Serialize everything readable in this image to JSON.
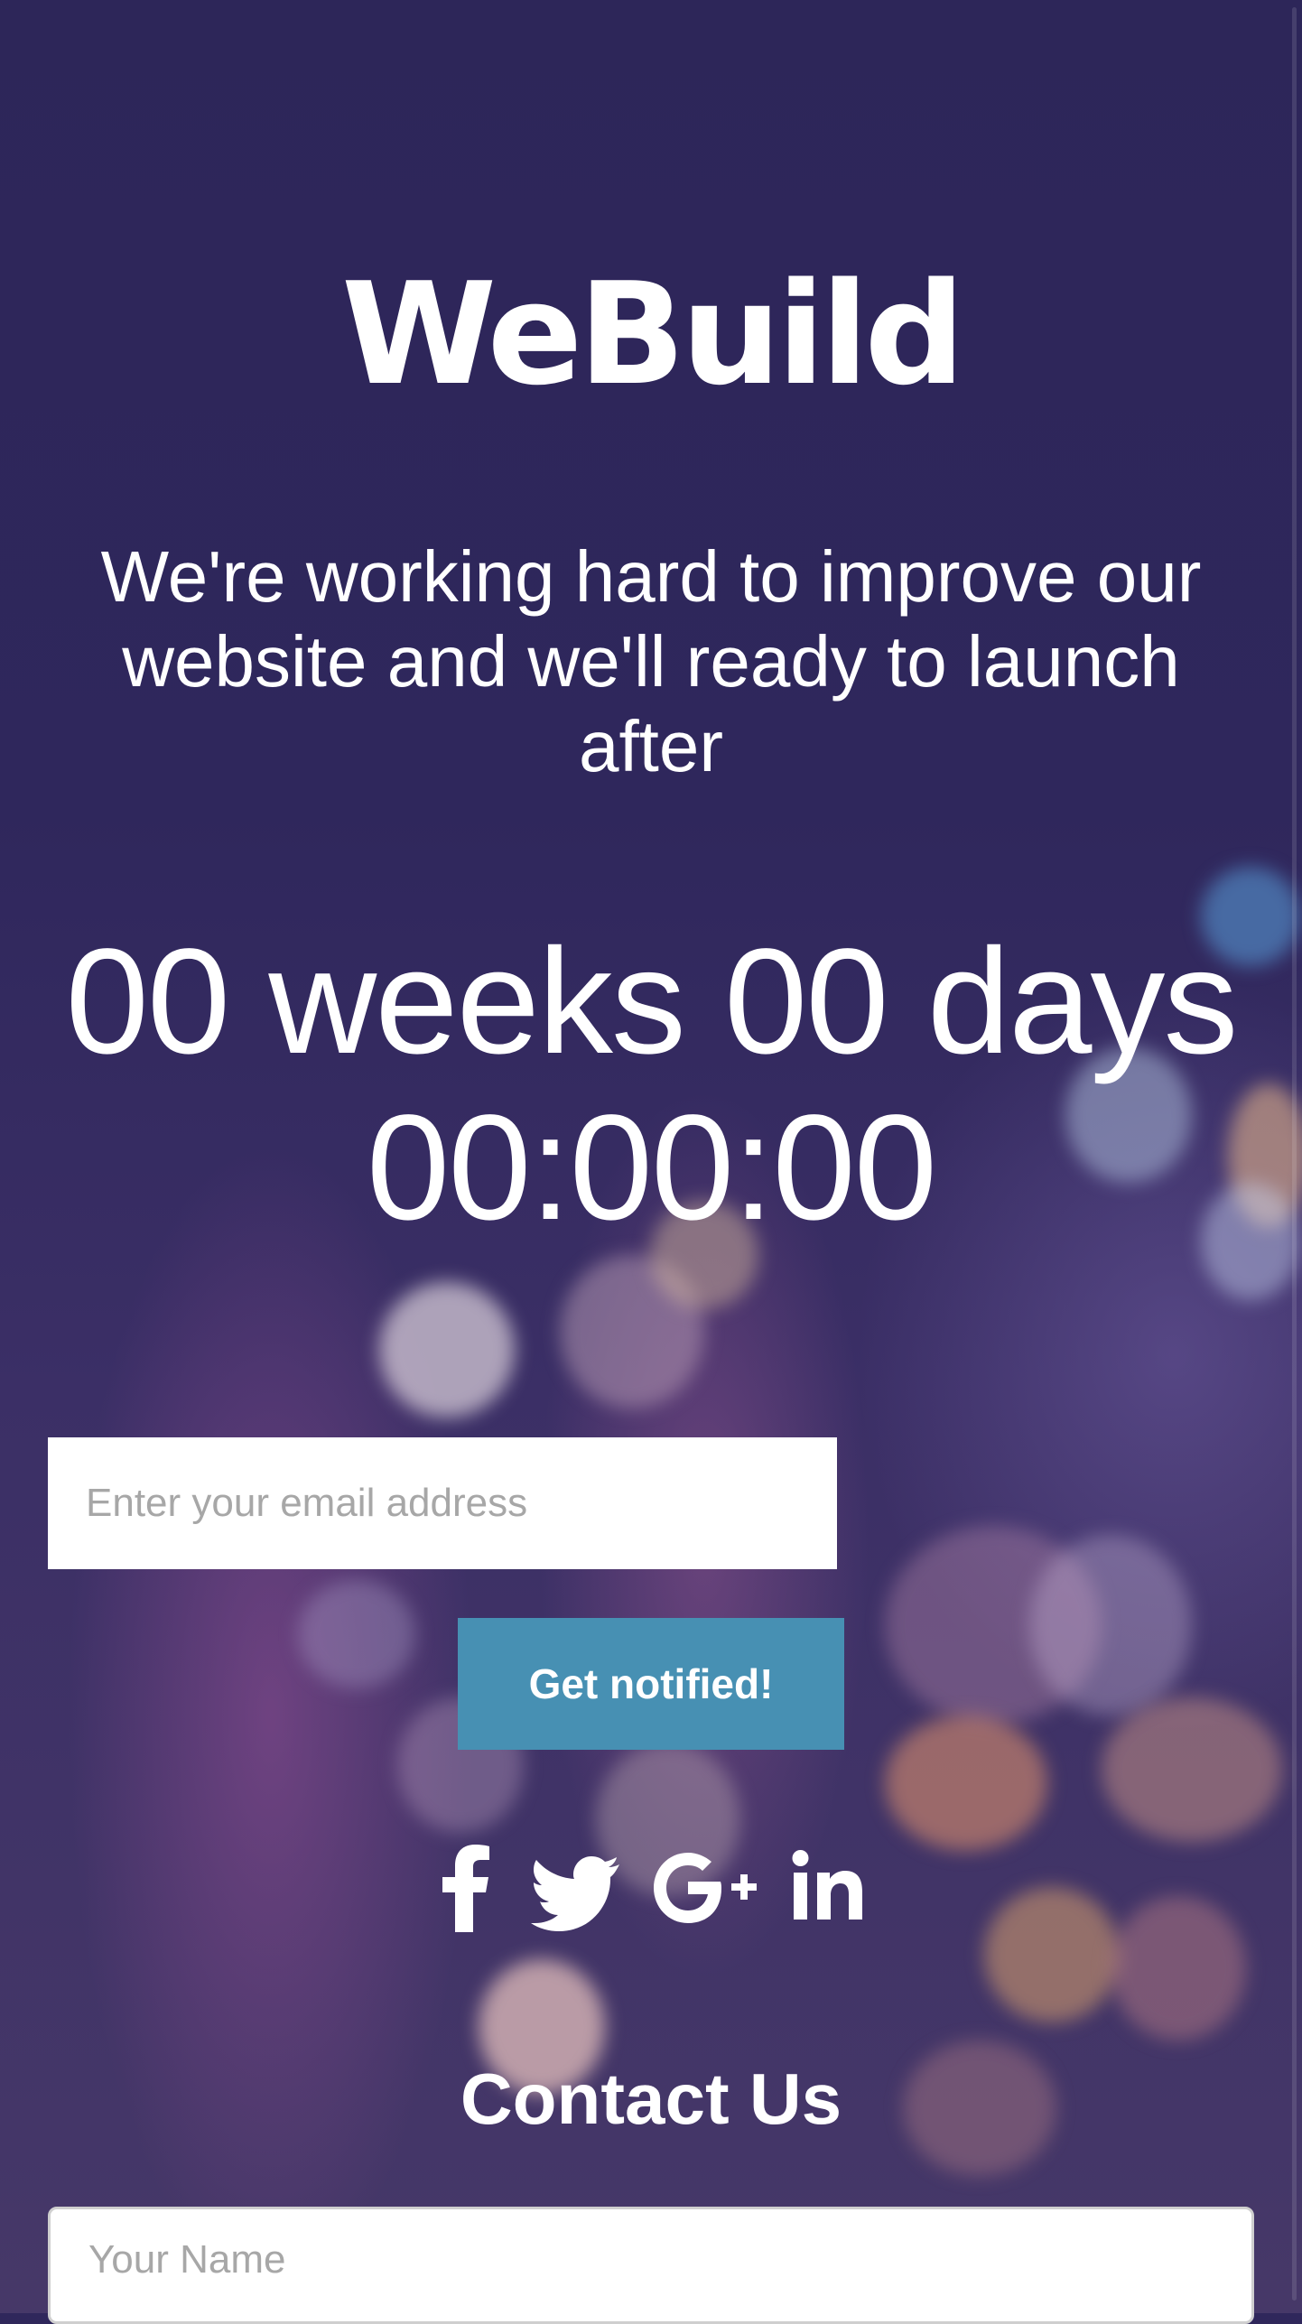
{
  "brand": {
    "name": "WeBuild"
  },
  "hero": {
    "tagline": "We're working hard to improve our website and we'll ready to launch after"
  },
  "countdown": {
    "weeks": "00",
    "weeks_label": "weeks",
    "days": "00",
    "days_label": "days",
    "time": "00:00:00"
  },
  "subscribe": {
    "email_placeholder": "Enter your email address",
    "email_value": "",
    "button_label": "Get notified!"
  },
  "social": [
    {
      "icon": "facebook-icon",
      "glyph": "f"
    },
    {
      "icon": "twitter-icon",
      "glyph": "🐦"
    },
    {
      "icon": "google-plus-icon",
      "glyph": "G+"
    },
    {
      "icon": "linkedin-icon",
      "glyph": "in"
    }
  ],
  "contact": {
    "title": "Contact Us",
    "name_placeholder": "Your Name",
    "name_value": ""
  },
  "colors": {
    "background": "#2f275b",
    "button": "#4790b3",
    "text": "#ffffff"
  }
}
